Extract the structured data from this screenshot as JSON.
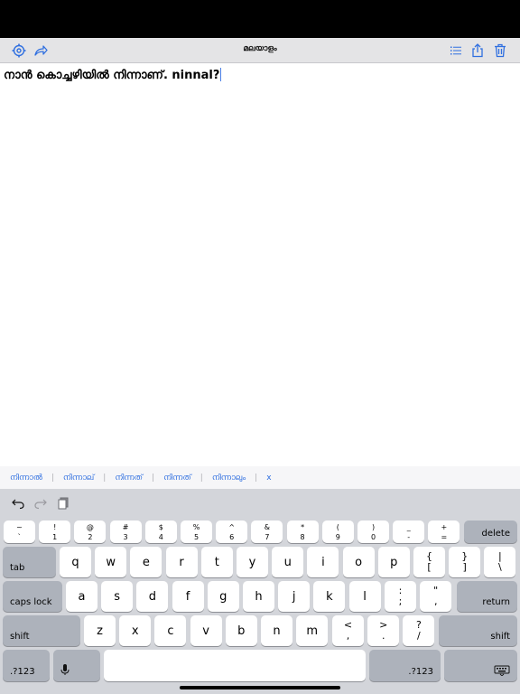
{
  "nav": {
    "title": "മലയാളം",
    "icons": [
      "settings-icon",
      "share-arrow-icon",
      "list-icon",
      "export-icon",
      "trash-icon"
    ]
  },
  "editor": {
    "text": "നാൻ കൊച്ചഴിയിൽ നിന്നാണ്. ninnal?"
  },
  "suggestions": [
    "നിന്നാൽ",
    "നിന്നാല്",
    "നിന്നത്",
    "നിന്നത്",
    "നിന്നാലും",
    "x"
  ],
  "keyboard": {
    "toolbar_icons": [
      "undo-icon",
      "redo-icon",
      "clipboard-icon"
    ],
    "number_row": [
      {
        "top": "~",
        "bottom": "`"
      },
      {
        "top": "!",
        "bottom": "1"
      },
      {
        "top": "@",
        "bottom": "2"
      },
      {
        "top": "#",
        "bottom": "3"
      },
      {
        "top": "$",
        "bottom": "4"
      },
      {
        "top": "%",
        "bottom": "5"
      },
      {
        "top": "^",
        "bottom": "6"
      },
      {
        "top": "&",
        "bottom": "7"
      },
      {
        "top": "*",
        "bottom": "8"
      },
      {
        "top": "(",
        "bottom": "9"
      },
      {
        "top": ")",
        "bottom": "0"
      },
      {
        "top": "_",
        "bottom": "-"
      },
      {
        "top": "+",
        "bottom": "="
      }
    ],
    "delete_label": "delete",
    "tab_label": "tab",
    "row_q": [
      "q",
      "w",
      "e",
      "r",
      "t",
      "y",
      "u",
      "i",
      "o",
      "p"
    ],
    "row_q_symbols": [
      {
        "top": "{",
        "bottom": "["
      },
      {
        "top": "}",
        "bottom": "]"
      },
      {
        "top": "|",
        "bottom": "\\"
      }
    ],
    "caps_label": "caps lock",
    "row_a": [
      "a",
      "s",
      "d",
      "f",
      "g",
      "h",
      "j",
      "k",
      "l"
    ],
    "row_a_symbols": [
      {
        "top": ":",
        "bottom": ";"
      },
      {
        "top": "\"",
        "bottom": ","
      }
    ],
    "return_label": "return",
    "shift_label": "shift",
    "row_z": [
      "z",
      "x",
      "c",
      "v",
      "b",
      "n",
      "m"
    ],
    "row_z_symbols": [
      {
        "top": "<",
        "bottom": ","
      },
      {
        "top": ">",
        "bottom": "."
      },
      {
        "top": "?",
        "bottom": "/"
      }
    ],
    "num_label": ".?123",
    "mic_icon": "microphone-icon",
    "hide_icon": "keyboard-hide-icon"
  }
}
